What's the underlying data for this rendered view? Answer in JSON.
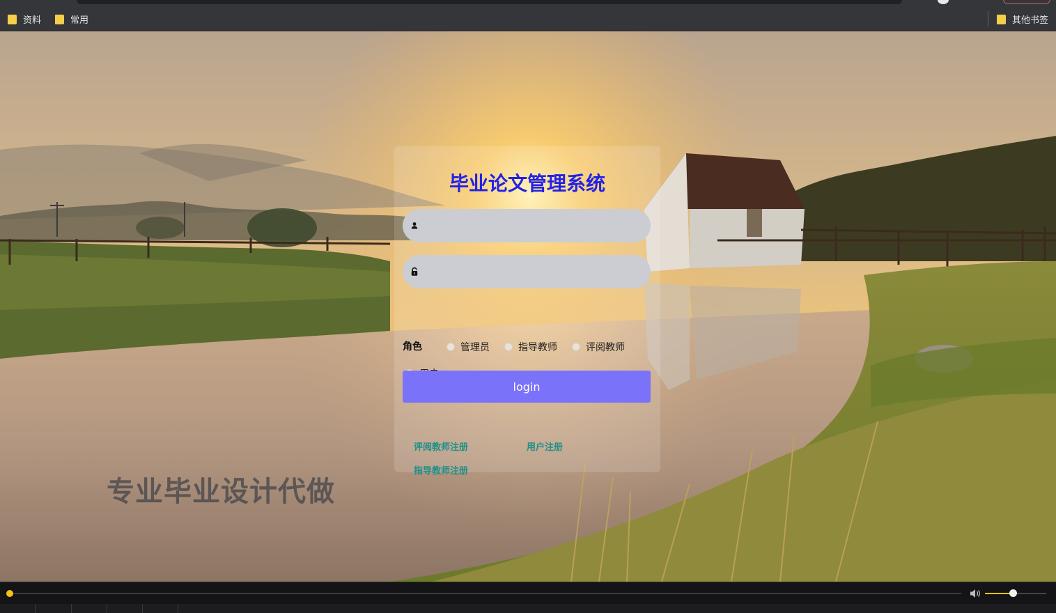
{
  "browser": {
    "bookmarks": [
      {
        "label": "资料"
      },
      {
        "label": "常用"
      }
    ],
    "other_bookmarks": "其他书签"
  },
  "login": {
    "title": "毕业论文管理系统",
    "username_placeholder": "",
    "password_placeholder": "",
    "role_label": "角色",
    "roles": [
      "管理员",
      "指导教师",
      "评阅教师",
      "用户"
    ],
    "login_button": "login",
    "links": [
      "评阅教师注册",
      "用户注册",
      "指导教师注册"
    ]
  },
  "watermark": "专业毕业设计代做",
  "colors": {
    "title": "#2222e6",
    "button": "#7a72f8",
    "link": "#1f8f8a",
    "accent": "#f2c416"
  },
  "player": {
    "progress": 0.0,
    "volume": 0.45
  }
}
